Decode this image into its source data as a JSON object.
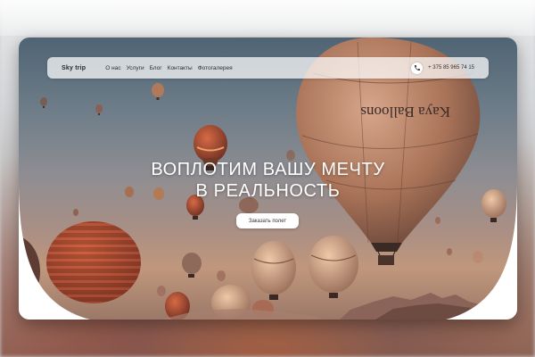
{
  "nav": {
    "brand": "Sky trip",
    "links": [
      "О нас",
      "Услуги",
      "Блог",
      "Контакты",
      "Фотогалерея"
    ],
    "phone": "+ 375 85 965 74 15",
    "phone_icon": "phone-icon"
  },
  "hero": {
    "headline_line1": "ВОПЛОТИМ ВАШУ МЕЧТУ",
    "headline_line2": "В РЕАЛЬНОСТЬ",
    "cta_label": "Заказать полет",
    "balloon_lettering": "Kaya Balloons"
  },
  "colors": {
    "accent": "#ffffff",
    "balloon_main": "#b8836a",
    "balloon_red": "#b84a35"
  }
}
